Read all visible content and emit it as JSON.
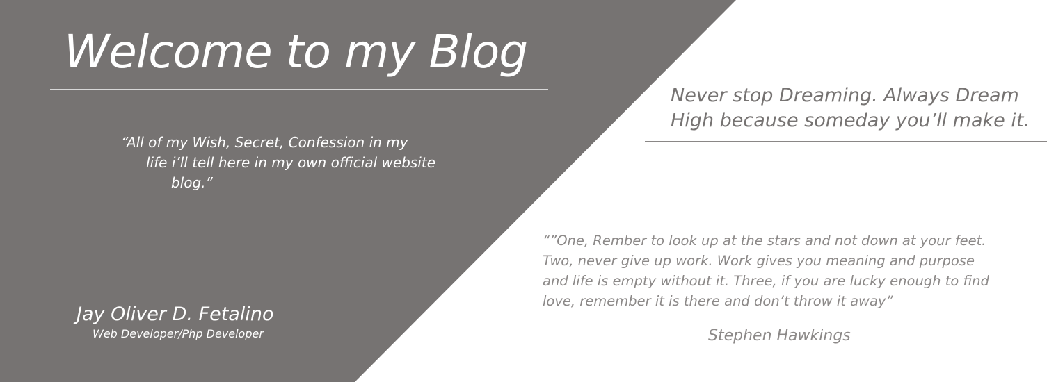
{
  "header": {
    "title": "Welcome to my Blog"
  },
  "intro": {
    "lines": [
      "“All of my Wish, Secret, Confession in my",
      "life i’ll tell here in my own official website",
      "blog.”"
    ]
  },
  "author": {
    "name": "Jay Oliver D. Fetalino",
    "role": "Web Developer/Php Developer"
  },
  "motto": {
    "lines": [
      "Never stop Dreaming. Always Dream",
      "High because someday you’ll make it."
    ]
  },
  "quote": {
    "lines": [
      "“”One, Rember to look up at the stars and not down at your feet.",
      "Two, never give up work. Work gives you meaning and purpose",
      "and life is empty without it. Three, if you are lucky enough to find",
      "love, remember it is there and don’t throw it away”"
    ],
    "attribution": "Stephen Hawkings"
  },
  "colors": {
    "panel": "#767372",
    "background": "#ffffff",
    "text_light": "#ffffff",
    "text_dark": "#767372",
    "text_muted": "#8c8988"
  }
}
